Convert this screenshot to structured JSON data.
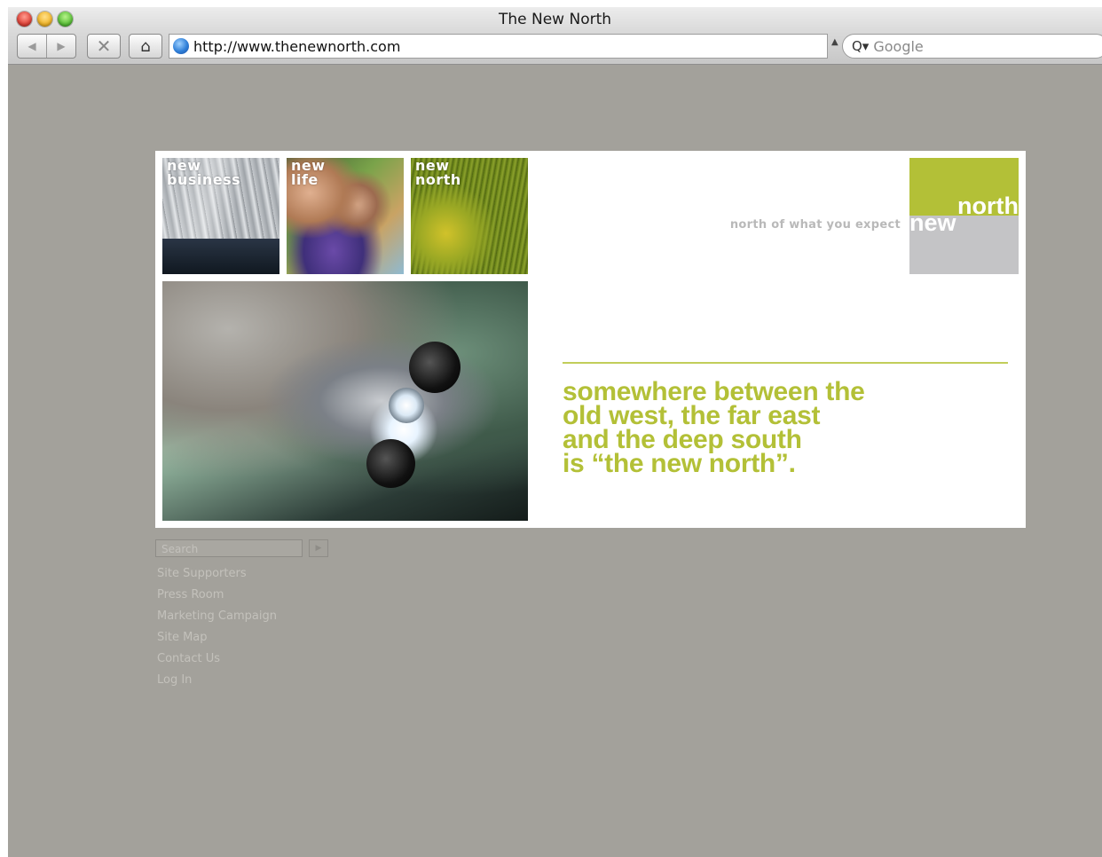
{
  "browser": {
    "window_title": "The New North",
    "url": "http://www.thenewnorth.com",
    "search_placeholder": "Google",
    "nav_back_glyph": "◀",
    "nav_forward_glyph": "▶",
    "stop_glyph": "✕",
    "home_glyph": "⌂",
    "search_glyph": "Q▾",
    "url_dropdown_glyph": "▲"
  },
  "tiles": {
    "business": {
      "line1": "new",
      "line2": "business"
    },
    "life": {
      "line1": "new",
      "line2": "life"
    },
    "north": {
      "line1": "new",
      "line2": "north"
    }
  },
  "logo": {
    "word_north": "north",
    "word_new": "new"
  },
  "tagline": "north of what you expect",
  "headline": {
    "line1": "somewhere between the",
    "line2": "old west, the far east",
    "line3": "and the deep south",
    "line4": "is “the new north”."
  },
  "site_search": {
    "placeholder": "Search",
    "go_glyph": "▶"
  },
  "footer_links": [
    "Site Supporters",
    "Press Room",
    "Marketing Campaign",
    "Site Map",
    "Contact Us",
    "Log In"
  ],
  "colors": {
    "page_background": "#a3a19b",
    "brand_green": "#b3c037",
    "logo_grey": "#c4c4c6"
  }
}
